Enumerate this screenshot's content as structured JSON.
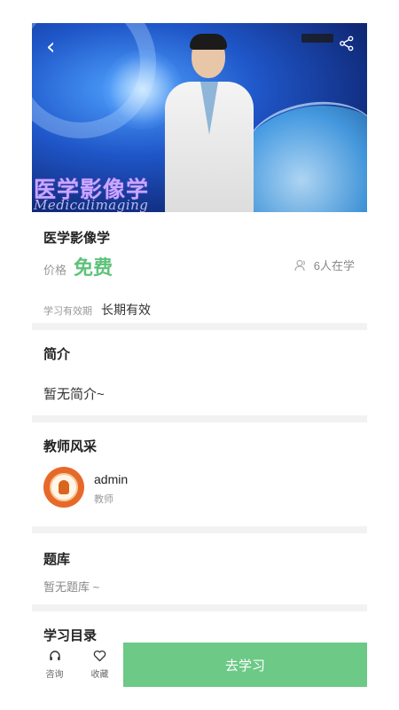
{
  "hero": {
    "banner_cn": "医学影像学",
    "banner_en": "Medicalimaging"
  },
  "course": {
    "title": "医学影像学",
    "price_label": "价格",
    "price_value": "免费",
    "learners": "6人在学",
    "validity_label": "学习有效期",
    "validity_value": "长期有效"
  },
  "intro": {
    "title": "简介",
    "text": "暂无简介~"
  },
  "teacher_section": {
    "title": "教师风采",
    "name": "admin",
    "role": "教师"
  },
  "question_bank": {
    "title": "题库",
    "text": "暂无题库 ~"
  },
  "catalog": {
    "title": "学习目录"
  },
  "bottom_bar": {
    "consult_label": "咨询",
    "favorite_label": "收藏",
    "cta_label": "去学习"
  },
  "colors": {
    "accent_green": "#6cc986",
    "price_green": "#5ec27a"
  }
}
